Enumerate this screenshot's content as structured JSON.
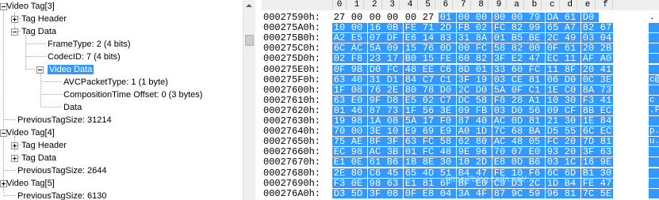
{
  "tree": {
    "items": [
      {
        "label": "Video Tag[3]",
        "expander": "minus"
      },
      {
        "label": "Tag Header",
        "expander": "plus"
      },
      {
        "label": "Tag Data",
        "expander": "minus"
      },
      {
        "label": "FrameType: 2  (4 bits)",
        "expander": null
      },
      {
        "label": "CodecID: 7  (4 bits)",
        "expander": null
      },
      {
        "label": "Video Data",
        "expander": "minus",
        "selected": true
      },
      {
        "label": "AVCPacketType: 1  (1 byte)",
        "expander": null
      },
      {
        "label": "CompositionTime Offset: 0  (3 bytes)",
        "expander": null
      },
      {
        "label": "Data",
        "expander": null
      },
      {
        "label": "PreviousTagSize: 31214",
        "expander": null
      },
      {
        "label": "Video Tag[4]",
        "expander": "minus"
      },
      {
        "label": "Tag Header",
        "expander": "plus"
      },
      {
        "label": "Tag Data",
        "expander": "plus"
      },
      {
        "label": "PreviousTagSize: 2644",
        "expander": null
      },
      {
        "label": "Video Tag[5]",
        "expander": "plus"
      },
      {
        "label": "PreviousTagSize: 6130",
        "expander": null
      }
    ]
  },
  "hex": {
    "columns": [
      "0",
      "1",
      "2",
      "3",
      "4",
      "5",
      "6",
      "7",
      "8",
      "9",
      "a",
      "b",
      "c",
      "d",
      "e",
      "f"
    ],
    "rows": [
      {
        "addr": "00027590h:",
        "bytes": [
          "27",
          "00",
          "00",
          "00",
          "00",
          "27",
          "01",
          "00",
          "00",
          "00",
          "00",
          "79",
          "DA",
          "61",
          "D0"
        ],
        "ascii": ".",
        "sel_start": 6
      },
      {
        "addr": "000275A0h:",
        "bytes": [
          "10",
          "00",
          "16",
          "0B",
          "FE",
          "71",
          "2D",
          "FB",
          "02",
          "FC",
          "82",
          "99",
          "65",
          "A7",
          "82",
          "67"
        ],
        "ascii": "",
        "sel_start": 0
      },
      {
        "addr": "000275B0h:",
        "bytes": [
          "A2",
          "E5",
          "07",
          "DF",
          "E6",
          "14",
          "83",
          "31",
          "8A",
          "01",
          "B5",
          "BE",
          "2C",
          "49",
          "03",
          "04"
        ],
        "ascii": "",
        "sel_start": 0
      },
      {
        "addr": "000275C0h:",
        "bytes": [
          "6C",
          "AC",
          "5A",
          "09",
          "15",
          "76",
          "0D",
          "00",
          "FC",
          "58",
          "82",
          "00",
          "0F",
          "61",
          "20",
          "2B"
        ],
        "ascii": "",
        "sel_start": 0
      },
      {
        "addr": "000275D0h:",
        "bytes": [
          "02",
          "F8",
          "23",
          "17",
          "B0",
          "15",
          "FE",
          "60",
          "82",
          "3F",
          "E2",
          "47",
          "EC",
          "11",
          "AF",
          "A0"
        ],
        "ascii": "",
        "sel_start": 0
      },
      {
        "addr": "000275E0h:",
        "bytes": [
          "0F",
          "9B",
          "D0",
          "FC",
          "48",
          "EE",
          "C6",
          "8D",
          "01",
          "33",
          "60",
          "FC",
          "11",
          "8F",
          "20",
          "41"
        ],
        "ascii": "",
        "sel_start": 0
      },
      {
        "addr": "000275F0h:",
        "bytes": [
          "63",
          "40",
          "31",
          "D1",
          "84",
          "C7",
          "C1",
          "3F",
          "19",
          "03",
          "CE",
          "81",
          "06",
          "D0",
          "0C",
          "3E"
        ],
        "ascii": "c@",
        "sel_start": 0
      },
      {
        "addr": "00027600h:",
        "bytes": [
          "1F",
          "08",
          "76",
          "2E",
          "80",
          "78",
          "D0",
          "2C",
          "D0",
          "5A",
          "0F",
          "C1",
          "1E",
          "C0",
          "8A",
          "73"
        ],
        "ascii": "",
        "sel_start": 0
      },
      {
        "addr": "00027610h:",
        "bytes": [
          "63",
          "E0",
          "9F",
          "D8",
          "E5",
          "02",
          "C7",
          "DC",
          "58",
          "F8",
          "28",
          "A1",
          "10",
          "30",
          "F3",
          "41"
        ],
        "ascii": "c",
        "sel_start": 0
      },
      {
        "addr": "00027620h:",
        "bytes": [
          "01",
          "46",
          "87",
          "73",
          "1F",
          "56",
          "3E",
          "09",
          "FB",
          "03",
          "D0",
          "56",
          "09",
          "CF",
          "8B",
          "EC"
        ],
        "ascii": ".F",
        "sel_start": 0
      },
      {
        "addr": "00027630h:",
        "bytes": [
          "19",
          "98",
          "1A",
          "08",
          "5A",
          "17",
          "F0",
          "87",
          "40",
          "AC",
          "0D",
          "81",
          "21",
          "30",
          "1E",
          "84"
        ],
        "ascii": "",
        "sel_start": 0
      },
      {
        "addr": "00027640h:",
        "bytes": [
          "70",
          "00",
          "3E",
          "10",
          "E9",
          "69",
          "E9",
          "A0",
          "1D",
          "7C",
          "68",
          "BA",
          "D5",
          "55",
          "6C",
          "EC"
        ],
        "ascii": "p.",
        "sel_start": 0
      },
      {
        "addr": "00027650h:",
        "bytes": [
          "75",
          "AE",
          "8F",
          "3F",
          "63",
          "FC",
          "58",
          "62",
          "80",
          "AC",
          "48",
          "05",
          "FC",
          "20",
          "7D",
          "81"
        ],
        "ascii": "u.",
        "sel_start": 0
      },
      {
        "addr": "00027660h:",
        "bytes": [
          "EC",
          "98",
          "AC",
          "3B",
          "01",
          "FC",
          "48",
          "9E",
          "96",
          "70",
          "07",
          "E0",
          "93",
          "20",
          "3F",
          "63"
        ],
        "ascii": "",
        "sel_start": 0
      },
      {
        "addr": "00027670h:",
        "bytes": [
          "E1",
          "0E",
          "61",
          "B6",
          "1B",
          "8E",
          "30",
          "10",
          "2D",
          "E8",
          "0D",
          "B6",
          "03",
          "1C",
          "16",
          "9E"
        ],
        "ascii": "",
        "sel_start": 0
      },
      {
        "addr": "00027680h:",
        "bytes": [
          "2E",
          "80",
          "C6",
          "45",
          "65",
          "4D",
          "51",
          "B4",
          "47",
          "FE",
          "10",
          "F6",
          "6C",
          "6D",
          "B1",
          "30"
        ],
        "ascii": "",
        "sel_start": 0
      },
      {
        "addr": "00027690h:",
        "bytes": [
          "F3",
          "0E",
          "98",
          "63",
          "E1",
          "81",
          "6F",
          "BF",
          "E0",
          "C9",
          "D3",
          "2C",
          "1D",
          "B4",
          "FE",
          "47"
        ],
        "ascii": "",
        "sel_start": 0
      },
      {
        "addr": "000276A0h:",
        "bytes": [
          "D3",
          "5D",
          "3F",
          "08",
          "0F",
          "E8",
          "04",
          "3A",
          "4F",
          "87",
          "9C",
          "59",
          "96",
          "81",
          "7C",
          "5E"
        ],
        "ascii": "",
        "sel_start": 0
      }
    ]
  },
  "watermark": "https://blog.csdn.net/..."
}
